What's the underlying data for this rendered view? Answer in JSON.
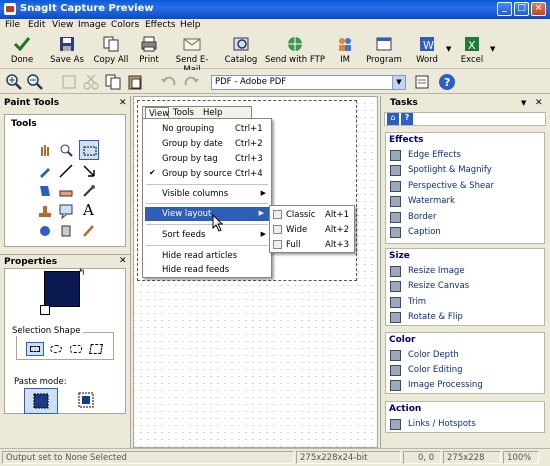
{
  "window": {
    "title": "SnagIt Capture Preview",
    "buttons": [
      "_",
      "□",
      "×"
    ]
  },
  "menubar": [
    "File",
    "Edit",
    "View",
    "Image",
    "Colors",
    "Effects",
    "Help"
  ],
  "toolbar1": [
    {
      "label": "Done",
      "icon": "done-check-icon"
    },
    {
      "label": "Save As",
      "icon": "floppy-icon"
    },
    {
      "label": "Copy All",
      "icon": "copy-icon"
    },
    {
      "label": "Print",
      "icon": "printer-icon"
    },
    {
      "label": "Send E-Mail",
      "icon": "envelope-icon"
    },
    {
      "label": "Catalog",
      "icon": "catalog-icon"
    },
    {
      "label": "Send with FTP",
      "icon": "ftp-icon"
    },
    {
      "label": "IM",
      "icon": "im-icon"
    },
    {
      "label": "Program",
      "icon": "program-icon"
    },
    {
      "label": "Word",
      "icon": "word-icon"
    },
    {
      "label": "Excel",
      "icon": "excel-icon"
    }
  ],
  "toolbar2": {
    "pdf_select": "PDF - Adobe PDF"
  },
  "left_panel": {
    "title": "Paint Tools",
    "tools_title": "Tools",
    "properties_title": "Properties",
    "selection_shape_label": "Selection Shape",
    "paste_mode_label": "Paste mode:"
  },
  "view_menu": {
    "header": [
      "View",
      "Tools",
      "Help"
    ],
    "items": [
      {
        "label": "No grouping",
        "shortcut": "Ctrl+1"
      },
      {
        "label": "Group by date",
        "shortcut": "Ctrl+2"
      },
      {
        "label": "Group by tag",
        "shortcut": "Ctrl+3"
      },
      {
        "label": "Group by source",
        "shortcut": "Ctrl+4",
        "checked": true
      },
      {
        "label": "Visible columns",
        "submenu": true
      },
      {
        "label": "View layout",
        "submenu": true,
        "highlighted": true
      },
      {
        "label": "Sort feeds",
        "submenu": true
      },
      {
        "label": "Hide read articles"
      },
      {
        "label": "Hide read feeds"
      }
    ],
    "submenu": [
      {
        "label": "Classic",
        "shortcut": "Alt+1"
      },
      {
        "label": "Wide",
        "shortcut": "Alt+2"
      },
      {
        "label": "Full",
        "shortcut": "Alt+3"
      }
    ]
  },
  "tasks": {
    "title": "Tasks",
    "groups": [
      {
        "title": "Effects",
        "items": [
          "Edge Effects",
          "Spotlight & Magnify",
          "Perspective & Shear",
          "Watermark",
          "Border",
          "Caption"
        ]
      },
      {
        "title": "Size",
        "items": [
          "Resize Image",
          "Resize Canvas",
          "Trim",
          "Rotate & Flip"
        ]
      },
      {
        "title": "Color",
        "items": [
          "Color Depth",
          "Color Editing",
          "Image Processing"
        ]
      },
      {
        "title": "Action",
        "items": [
          "Links / Hotspots"
        ]
      }
    ]
  },
  "status": {
    "message": "Output set to None Selected",
    "image_info": "275x228x24-bit",
    "coords": "0, 0",
    "size": "275x228",
    "zoom": "100%"
  }
}
